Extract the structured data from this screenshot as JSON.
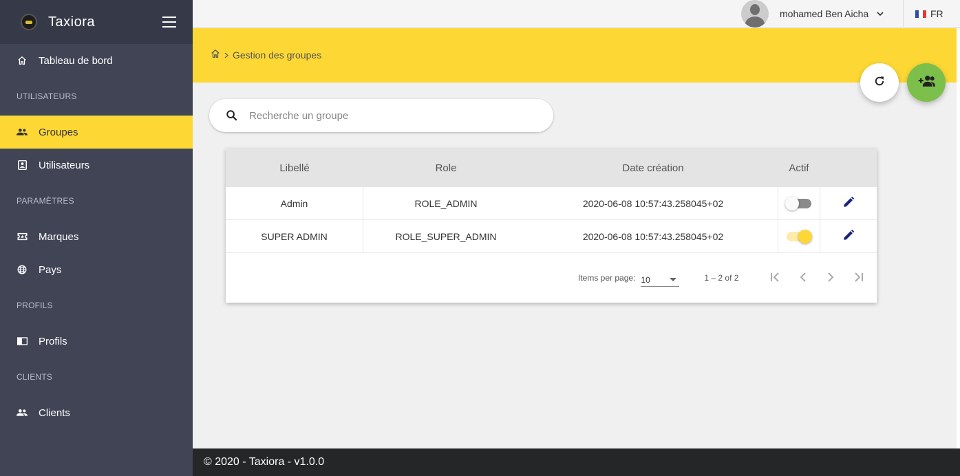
{
  "app": {
    "title": "Taxiora"
  },
  "sidebar": {
    "items": [
      {
        "label": "Tableau de bord",
        "icon": "home-icon"
      },
      {
        "section": "UTILISATEURS"
      },
      {
        "label": "Groupes",
        "icon": "group-icon",
        "active": true
      },
      {
        "label": "Utilisateurs",
        "icon": "contact-icon"
      },
      {
        "section": "PARAMÈTRES"
      },
      {
        "label": "Marques",
        "icon": "ticket-icon"
      },
      {
        "label": "Pays",
        "icon": "globe-icon"
      },
      {
        "section": "PROFILS"
      },
      {
        "label": "Profils",
        "icon": "chrome-reader-icon"
      },
      {
        "section": "CLIENTS"
      },
      {
        "label": "Clients",
        "icon": "group-icon"
      }
    ]
  },
  "topbar": {
    "user_name": "mohamed Ben Aicha",
    "language": "FR"
  },
  "breadcrumb": {
    "current": "Gestion des groupes"
  },
  "search": {
    "placeholder": "Recherche un groupe",
    "value": ""
  },
  "table": {
    "headers": [
      "Libellé",
      "Role",
      "Date création",
      "Actif"
    ],
    "rows": [
      {
        "libelle": "Admin",
        "role": "ROLE_ADMIN",
        "date": "2020-06-08 10:57:43.258045+02",
        "actif": false
      },
      {
        "libelle": "SUPER ADMIN",
        "role": "ROLE_SUPER_ADMIN",
        "date": "2020-06-08 10:57:43.258045+02",
        "actif": true
      }
    ]
  },
  "paginator": {
    "items_per_page_label": "Items per page:",
    "items_per_page": "10",
    "range": "1 – 2 of 2"
  },
  "footer": {
    "text": "© 2020 - Taxiora - v1.0.0"
  },
  "colors": {
    "accent": "#fdd835",
    "sidebar": "#404455",
    "add_fab": "#7cbf4a",
    "edit_icon": "#1a237e"
  }
}
